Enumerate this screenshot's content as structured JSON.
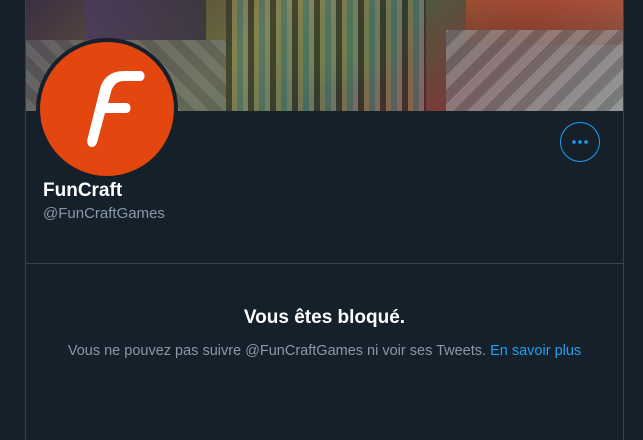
{
  "profile": {
    "name": "FunCraft",
    "handle": "@FunCraftGames",
    "avatar_letter": "F",
    "avatar_color": "#e3460f"
  },
  "blocked": {
    "title": "Vous êtes bloqué.",
    "description": "Vous ne pouvez pas suivre @FunCraftGames ni voir ses Tweets.",
    "learn_more": "En savoir plus"
  },
  "icons": {
    "more": "more-horizontal-icon"
  },
  "colors": {
    "background": "#15202b",
    "border": "#38444d",
    "accent": "#1da1f2",
    "secondary_text": "#8899a6"
  }
}
